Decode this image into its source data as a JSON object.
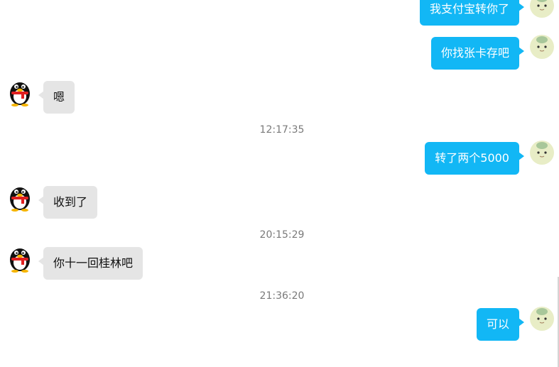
{
  "messages": [
    {
      "text": "我支付宝转你了"
    },
    {
      "text": "你找张卡存吧"
    },
    {
      "text": "嗯"
    },
    {
      "text": "转了两个5000"
    },
    {
      "text": "收到了"
    },
    {
      "text": "你十一回桂林吧"
    },
    {
      "text": "可以"
    }
  ],
  "timestamps": [
    "12:17:35",
    "20:15:29",
    "21:36:20"
  ],
  "avatars": {
    "me": "cartoon-character-avatar",
    "contact": "qq-penguin-avatar"
  },
  "colors": {
    "outgoing_bubble": "#12b7f5",
    "incoming_bubble": "#e5e5e5",
    "timestamp_text": "#7a7a7a"
  }
}
